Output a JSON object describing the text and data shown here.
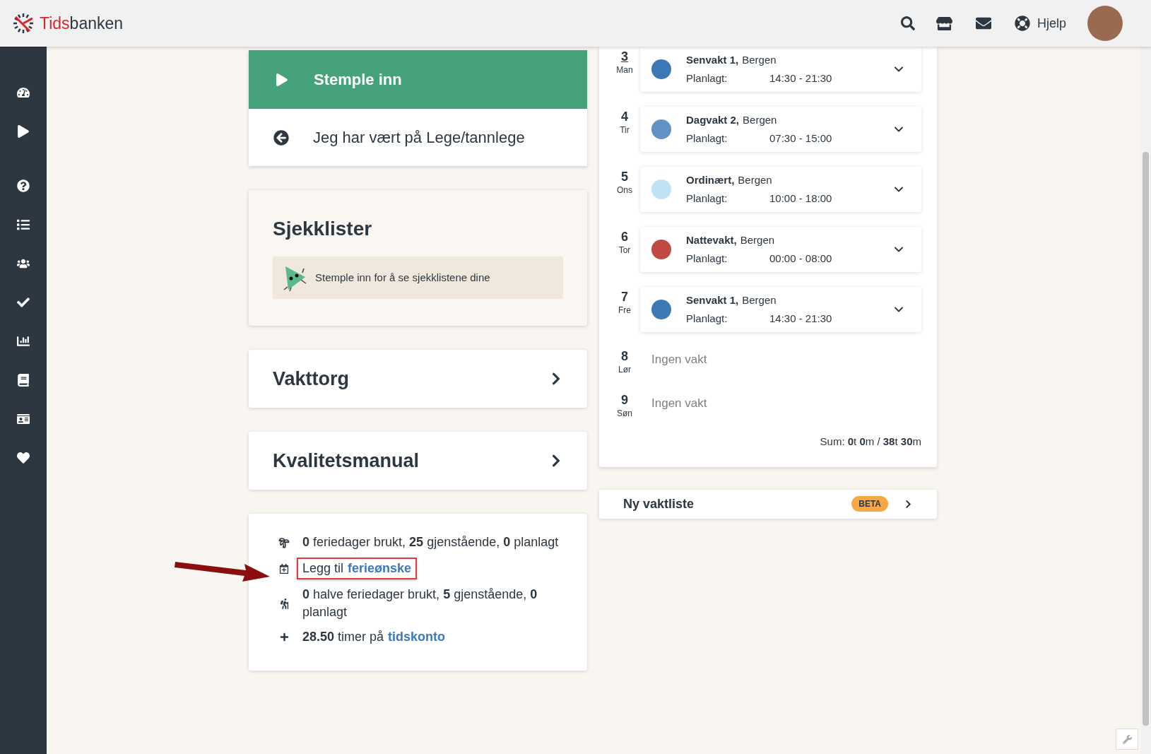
{
  "header": {
    "logo_first": "Tids",
    "logo_second": "banken",
    "help": "Hjelp"
  },
  "clock_card": {
    "primary_action": "Stemple inn",
    "secondary_action": "Jeg har vært på Lege/tannlege"
  },
  "checklists": {
    "title": "Sjekklister",
    "notice": "Stemple inn for å se sjekklistene dine"
  },
  "link_cards": [
    {
      "label": "Vakttorg"
    },
    {
      "label": "Kvalitetsmanual"
    }
  ],
  "vacation": [
    {
      "kind": "palm",
      "text": "**0** feriedager brukt, **25** gjenstående, **0** planlagt",
      "highlighted": false
    },
    {
      "kind": "calendar",
      "text": "Legg til",
      "link": "ferieønske",
      "highlighted": true
    },
    {
      "kind": "hiking",
      "text": "**0** halve feriedager brukt, **5** gjenstående, **0** planlagt",
      "highlighted": false
    },
    {
      "kind": "plus",
      "text": "**28.50** timer på",
      "link": "tidskonto",
      "highlighted": false
    }
  ],
  "schedule": {
    "days": [
      {
        "kind": "shift",
        "day": "3",
        "weekday": "Man",
        "today": true,
        "shift": "Senvakt 1,",
        "location": "Bergen",
        "planned_label": "Planlagt:",
        "time": "14:30 - 21:30",
        "color": "#3f78b7"
      },
      {
        "kind": "shift",
        "day": "4",
        "weekday": "Tir",
        "today": false,
        "shift": "Dagvakt 2,",
        "location": "Bergen",
        "planned_label": "Planlagt:",
        "time": "07:30 - 15:00",
        "color": "#6393c6"
      },
      {
        "kind": "shift",
        "day": "5",
        "weekday": "Ons",
        "today": false,
        "shift": "Ordinært,",
        "location": "Bergen",
        "planned_label": "Planlagt:",
        "time": "10:00 - 18:00",
        "color": "#bfe3f3"
      },
      {
        "kind": "shift",
        "day": "6",
        "weekday": "Tor",
        "today": false,
        "shift": "Nattevakt,",
        "location": "Bergen",
        "planned_label": "Planlagt:",
        "time": "00:00 - 08:00",
        "color": "#bf4a44"
      },
      {
        "kind": "shift",
        "day": "7",
        "weekday": "Fre",
        "today": false,
        "shift": "Senvakt 1,",
        "location": "Bergen",
        "planned_label": "Planlagt:",
        "time": "14:30 - 21:30",
        "color": "#3f78b7"
      },
      {
        "kind": "empty",
        "day": "8",
        "weekday": "Lør",
        "today": false,
        "text": "Ingen vakt"
      },
      {
        "kind": "empty",
        "day": "9",
        "weekday": "Søn",
        "today": false,
        "text": "Ingen vakt"
      }
    ],
    "sum": "Sum: **0**t **0**m / **38**t **30**m"
  },
  "new_roster": {
    "label": "Ny vaktliste",
    "badge": "BETA"
  }
}
